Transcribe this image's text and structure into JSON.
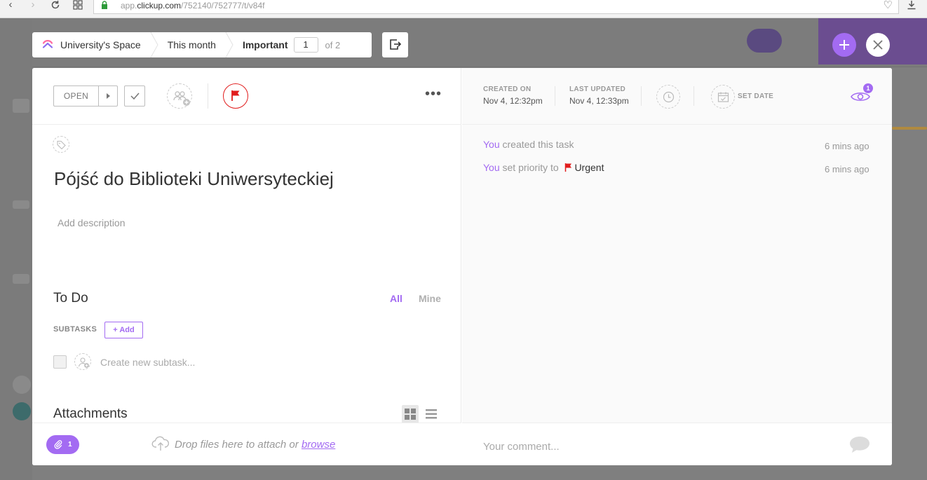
{
  "browser": {
    "url_prefix": "app.",
    "url_domain": "clickup.com",
    "url_path": "/752140/752777/t/v84f"
  },
  "breadcrumb": {
    "space": "University's Space",
    "list": "This month",
    "view": "Important",
    "page_current": "1",
    "page_total": "of 2"
  },
  "task": {
    "status": "OPEN",
    "title": "Pójść do Biblioteki Uniwersyteckiej",
    "description_placeholder": "Add description",
    "more": "•••"
  },
  "todo": {
    "title": "To Do",
    "filter_all": "All",
    "filter_mine": "Mine",
    "subtasks_label": "SUBTASKS",
    "add_label": "+ Add",
    "new_subtask_placeholder": "Create new subtask..."
  },
  "attachments": {
    "title": "Attachments",
    "count": "1",
    "drop_text": "Drop files here to attach or ",
    "browse": "browse"
  },
  "meta": {
    "created_label": "CREATED ON",
    "created_value": "Nov 4, 12:32pm",
    "updated_label": "LAST UPDATED",
    "updated_value": "Nov 4, 12:33pm",
    "set_date": "SET DATE",
    "watchers": "1"
  },
  "activity": [
    {
      "actor": "You",
      "text": " created this task",
      "time": "6 mins ago"
    },
    {
      "actor": "You",
      "text": " set priority to ",
      "priority": "Urgent",
      "time": "6 mins ago"
    }
  ],
  "comment": {
    "placeholder": "Your comment..."
  },
  "colors": {
    "accent": "#a36bf2",
    "urgent": "#e11d1d"
  },
  "icons": {
    "back": "arrow-left-icon",
    "forward": "arrow-right-icon",
    "reload": "reload-icon",
    "apps": "apps-grid-icon",
    "lock": "lock-icon",
    "favorite": "heart-icon",
    "download": "download-icon"
  }
}
